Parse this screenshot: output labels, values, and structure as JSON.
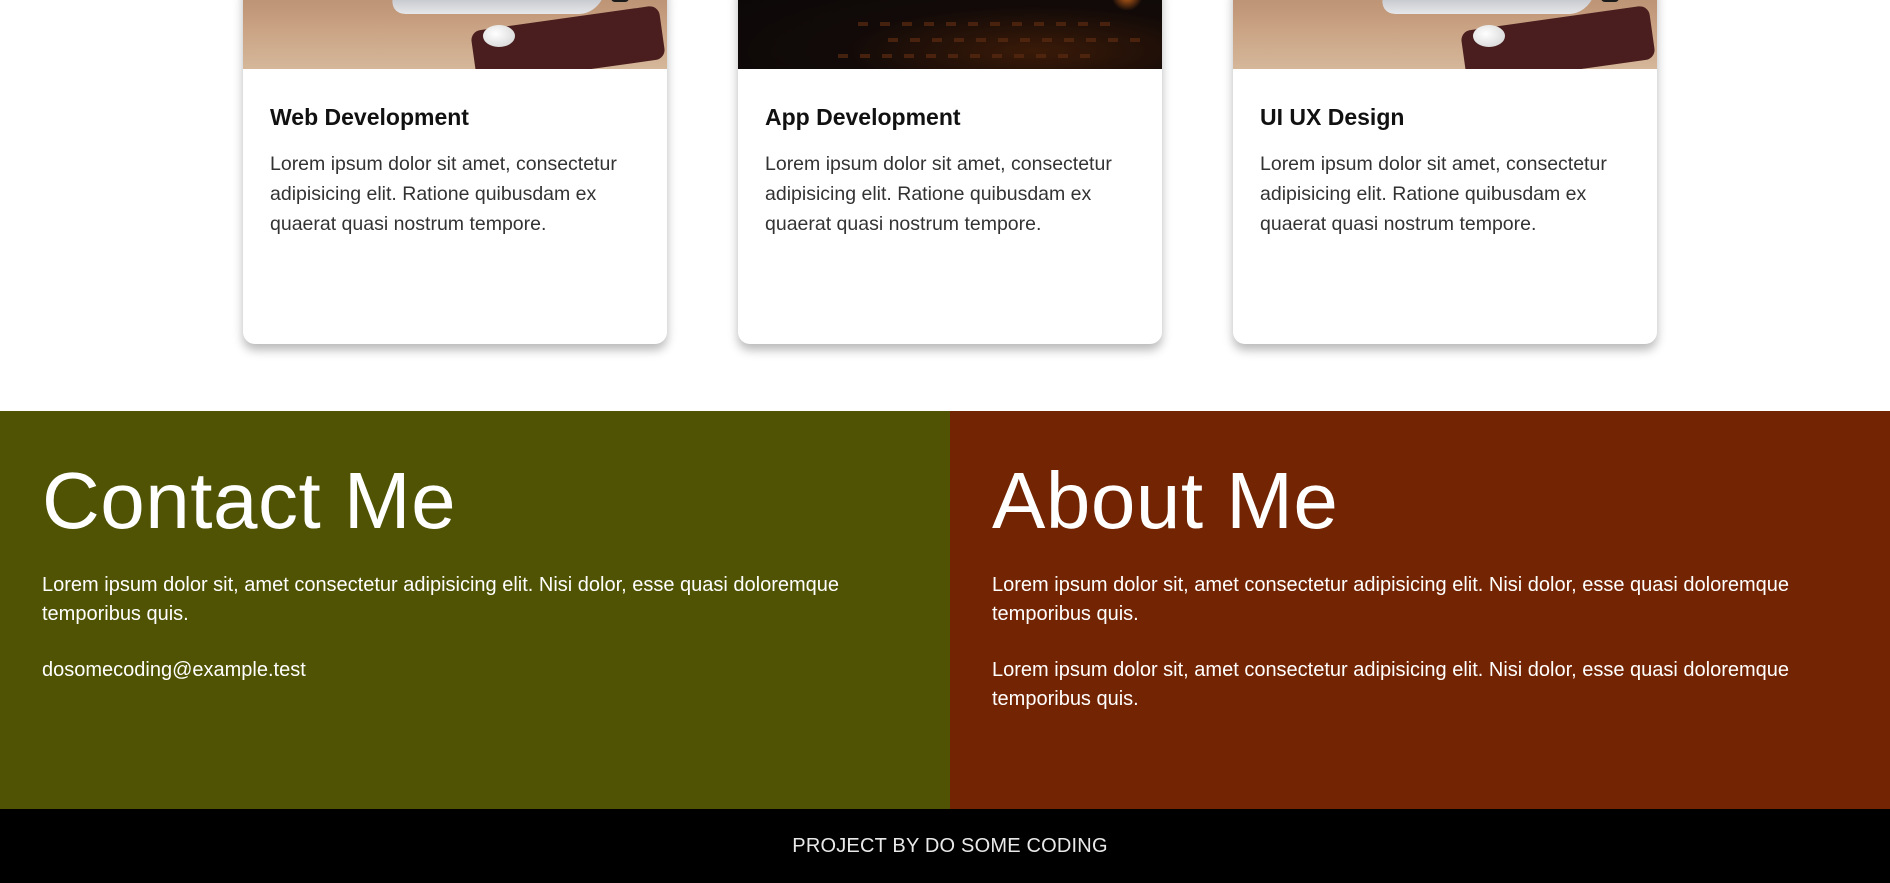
{
  "services": {
    "cards": [
      {
        "title": "Web Development",
        "text": "Lorem ipsum dolor sit amet, consectetur adipisicing elit. Ratione quibusdam ex quaerat quasi nostrum tempore.",
        "image": "laptop-desk-photo"
      },
      {
        "title": "App Development",
        "text": "Lorem ipsum dolor sit amet, consectetur adipisicing elit. Ratione quibusdam ex quaerat quasi nostrum tempore.",
        "image": "dark-keyboard-photo"
      },
      {
        "title": "UI UX Design",
        "text": "Lorem ipsum dolor sit amet, consectetur adipisicing elit. Ratione quibusdam ex quaerat quasi nostrum tempore.",
        "image": "laptop-desk-photo"
      }
    ]
  },
  "contact": {
    "title": "Contact Me",
    "text": "Lorem ipsum dolor sit, amet consectetur adipisicing elit. Nisi dolor, esse quasi doloremque temporibus quis.",
    "email": "dosomecoding@example.test",
    "background": "#4f5303"
  },
  "about": {
    "title": "About Me",
    "paragraphs": [
      "Lorem ipsum dolor sit, amet consectetur adipisicing elit. Nisi dolor, esse quasi doloremque temporibus quis.",
      "Lorem ipsum dolor sit, amet consectetur adipisicing elit. Nisi dolor, esse quasi doloremque temporibus quis."
    ],
    "background": "#732402"
  },
  "footer": {
    "text": "PROJECT BY DO SOME CODING",
    "background": "#000000"
  }
}
